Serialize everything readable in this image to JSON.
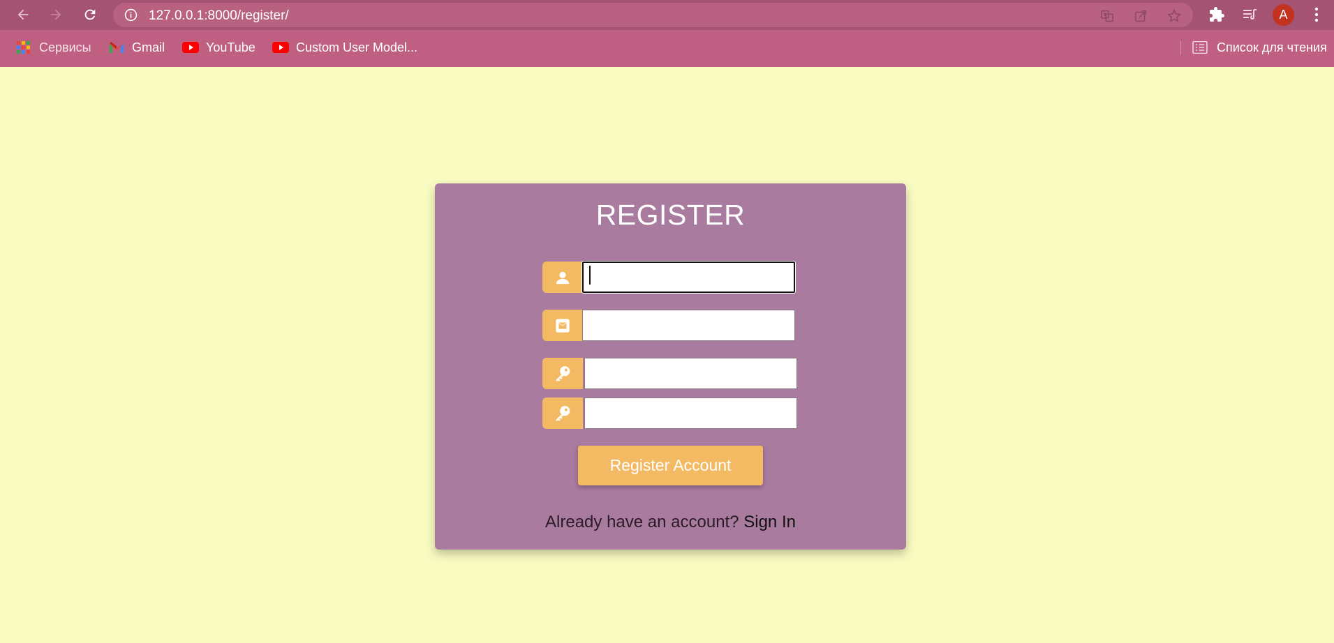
{
  "browser": {
    "url": "127.0.0.1:8000/register/",
    "avatar_letter": "A",
    "bookmarks": [
      {
        "label": "Сервисы",
        "icon": "apps-grid-icon"
      },
      {
        "label": "Gmail",
        "icon": "gmail-icon"
      },
      {
        "label": "YouTube",
        "icon": "youtube-icon"
      },
      {
        "label": "Custom User Model...",
        "icon": "youtube-icon"
      }
    ],
    "reading_list_label": "Список для чтения"
  },
  "register": {
    "title": "REGISTER",
    "fields": [
      {
        "icon": "user-icon",
        "value": "",
        "focused": true
      },
      {
        "icon": "envelope-icon",
        "value": ""
      },
      {
        "icon": "key-icon",
        "value": ""
      },
      {
        "icon": "key-icon",
        "value": ""
      }
    ],
    "submit_label": "Register Account",
    "footer_prompt": "Already have an account?",
    "footer_link": "Sign In"
  },
  "colors": {
    "page_background": "#f9fcc1",
    "card": "#a97b9f",
    "accent": "#f4ba63",
    "browser_toolbar": "#a55372",
    "bookmarks_bar": "#bf6083"
  }
}
